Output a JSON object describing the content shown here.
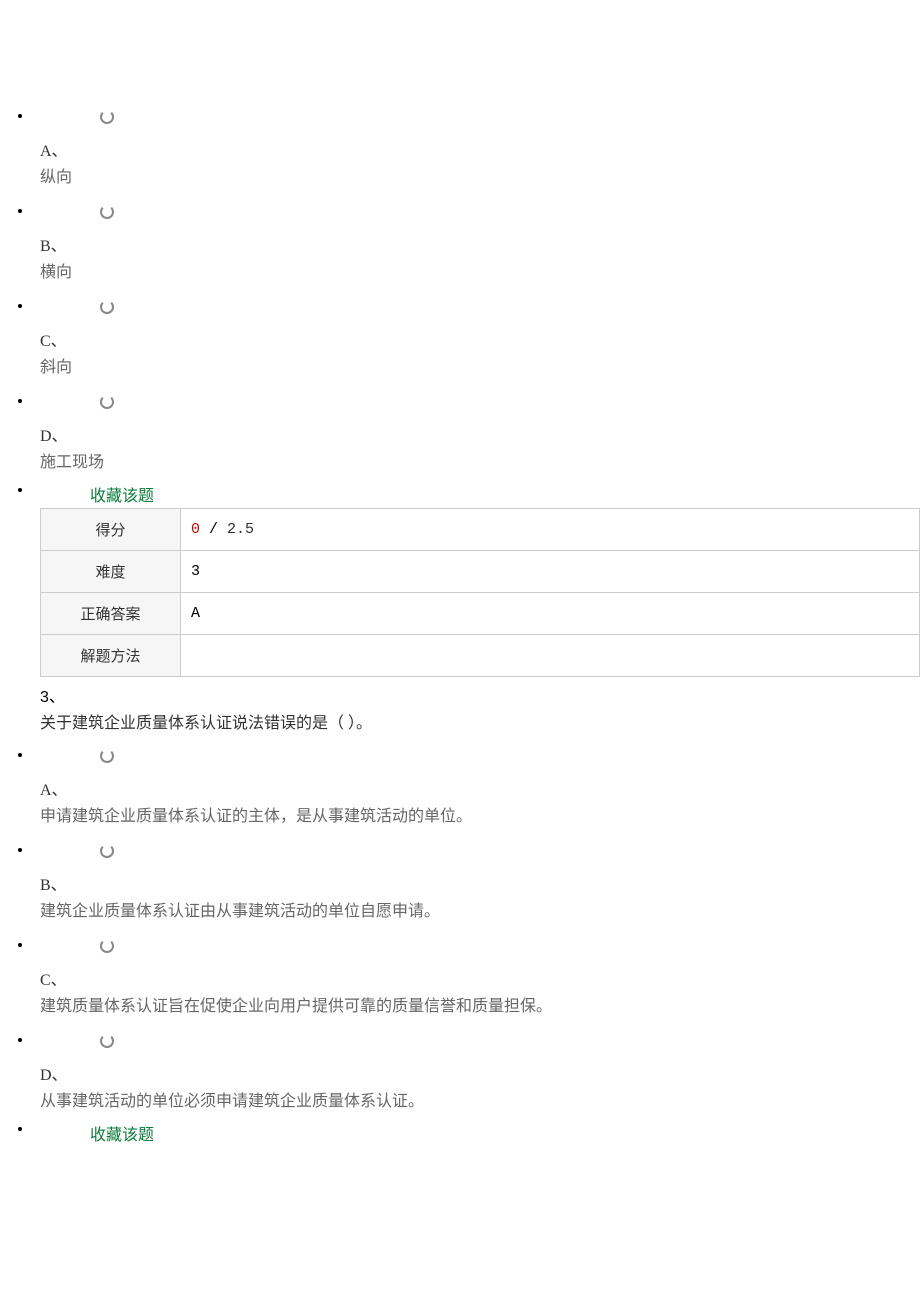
{
  "question2": {
    "options": [
      {
        "letter": "A、",
        "text": "纵向"
      },
      {
        "letter": "B、",
        "text": "横向"
      },
      {
        "letter": "C、",
        "text": "斜向"
      },
      {
        "letter": "D、",
        "text": "施工现场"
      }
    ],
    "favorite": "收藏该题",
    "table": {
      "scoreLabel": "得分",
      "scoreGot": "0",
      "scoreSep": " / ",
      "scoreTotal": "2.5",
      "difficultyLabel": "难度",
      "difficulty": "3",
      "answerLabel": "正确答案",
      "answer": "A",
      "methodLabel": "解题方法",
      "method": ""
    }
  },
  "question3": {
    "number": "3、",
    "text": "关于建筑企业质量体系认证说法错误的是（ ）。",
    "options": [
      {
        "letter": "A、",
        "text": "申请建筑企业质量体系认证的主体，是从事建筑活动的单位。"
      },
      {
        "letter": "B、",
        "text": "建筑企业质量体系认证由从事建筑活动的单位自愿申请。"
      },
      {
        "letter": "C、",
        "text": "建筑质量体系认证旨在促使企业向用户提供可靠的质量信誉和质量担保。"
      },
      {
        "letter": "D、",
        "text": "从事建筑活动的单位必须申请建筑企业质量体系认证。"
      }
    ],
    "favorite": "收藏该题"
  }
}
